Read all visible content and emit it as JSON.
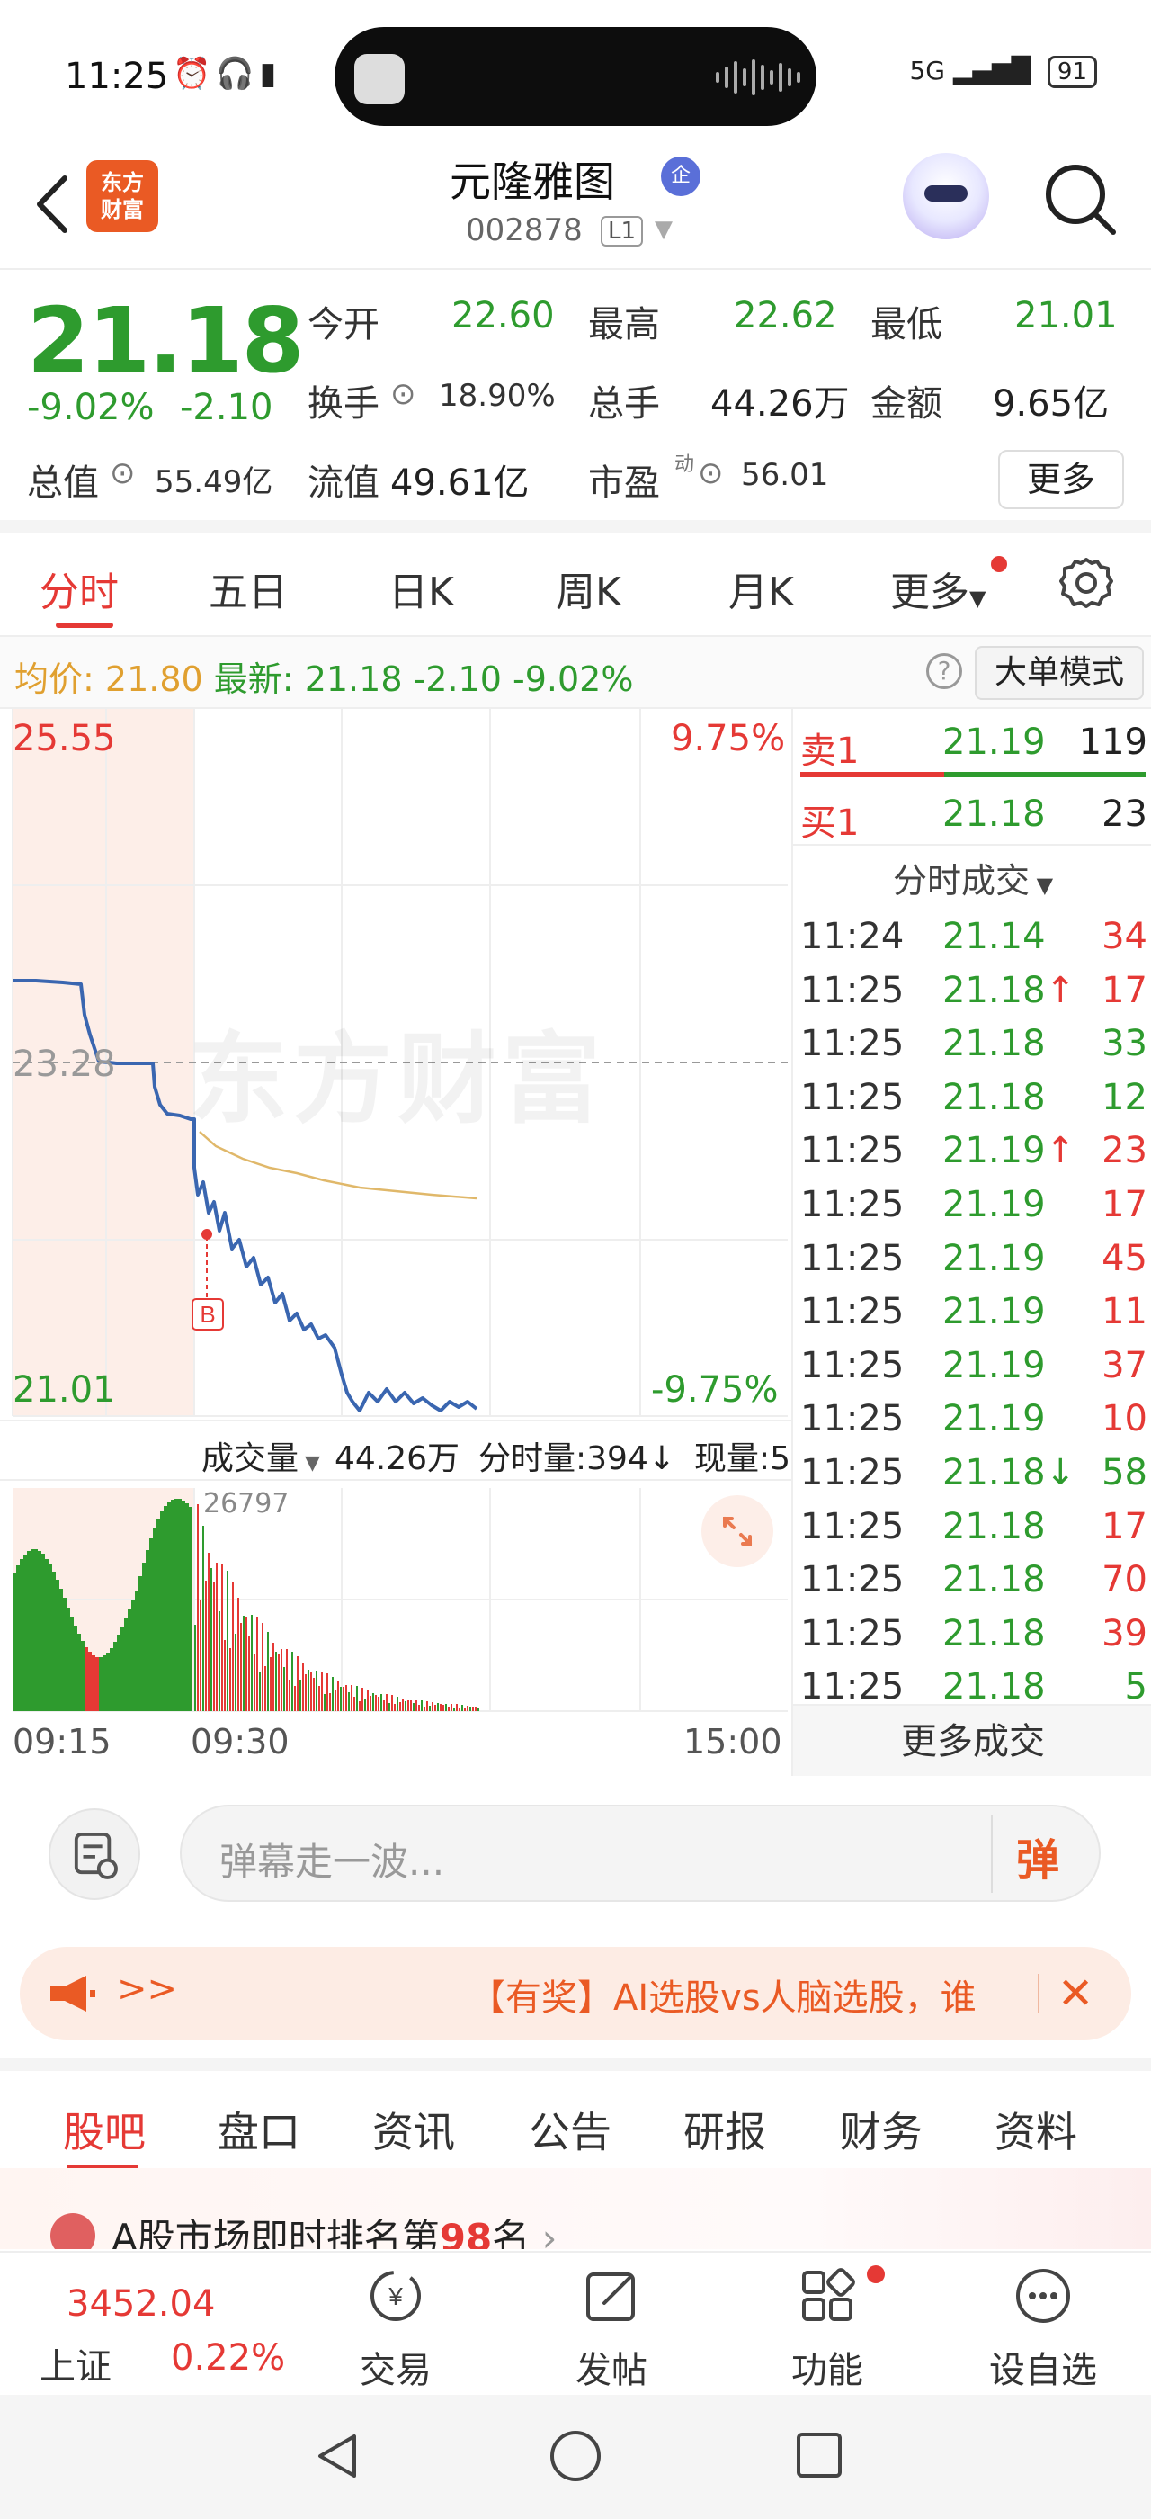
{
  "status_bar": {
    "time": "11:25",
    "network": "5G",
    "battery": "91"
  },
  "header": {
    "stock_name": "元隆雅图",
    "badge": "企",
    "stock_code": "002878",
    "level": "L1",
    "logo_text_1": "东方",
    "logo_text_2": "财富"
  },
  "quote": {
    "last_price": "21.18",
    "change_pct": "-9.02%",
    "change": "-2.10",
    "open_label": "今开",
    "open": "22.60",
    "high_label": "最高",
    "high": "22.62",
    "low_label": "最低",
    "low": "21.01",
    "turnover_label": "换手",
    "turnover": "18.90%",
    "volume_label": "总手",
    "volume": "44.26万",
    "amount_label": "金额",
    "amount": "9.65亿",
    "mcap_label": "总值",
    "mcap": "55.49亿",
    "float_label": "流值",
    "float_cap": "49.61亿",
    "pe_label": "市盈",
    "pe_sup": "动",
    "pe": "56.01",
    "more": "更多"
  },
  "tabs": [
    "分时",
    "五日",
    "日K",
    "周K",
    "月K",
    "更多"
  ],
  "info_row": {
    "avg_label": "均价:",
    "avg": "21.80",
    "latest_label": "最新:",
    "latest": "21.18",
    "change": "-2.10",
    "pct": "-9.02%",
    "big_order_mode": "大单模式"
  },
  "chart": {
    "price_high": "25.55",
    "pct_high": "9.75%",
    "price_mid": "23.28",
    "price_low": "21.01",
    "pct_low": "-9.75%",
    "watermark": "东方财富",
    "marker": "B",
    "volume_label": "成交量",
    "volume": "44.26万",
    "period_volume": "分时量:394↓",
    "current_volume": "现量:5",
    "volume_max": "26797",
    "time_start": "09:15",
    "time_open": "09:30",
    "time_end": "15:00",
    "colors": {
      "price_line": "#3a66b0",
      "avg_line": "#e0b86a",
      "up": "#e53935",
      "down": "#2e9b2e"
    }
  },
  "order_book": {
    "sell1_label": "卖1",
    "sell1_price": "21.19",
    "sell1_vol": "119",
    "buy1_label": "买1",
    "buy1_price": "21.18",
    "buy1_vol": "23"
  },
  "trades_header": "分时成交",
  "trades": [
    {
      "time": "11:24",
      "price": "21.14",
      "arrow": "",
      "vol": "34",
      "side": "red"
    },
    {
      "time": "11:25",
      "price": "21.18",
      "arrow": "↑",
      "vol": "17",
      "side": "red"
    },
    {
      "time": "11:25",
      "price": "21.18",
      "arrow": "",
      "vol": "33",
      "side": "green"
    },
    {
      "time": "11:25",
      "price": "21.18",
      "arrow": "",
      "vol": "12",
      "side": "green"
    },
    {
      "time": "11:25",
      "price": "21.19",
      "arrow": "↑",
      "vol": "23",
      "side": "red"
    },
    {
      "time": "11:25",
      "price": "21.19",
      "arrow": "",
      "vol": "17",
      "side": "red"
    },
    {
      "time": "11:25",
      "price": "21.19",
      "arrow": "",
      "vol": "45",
      "side": "red"
    },
    {
      "time": "11:25",
      "price": "21.19",
      "arrow": "",
      "vol": "11",
      "side": "red"
    },
    {
      "time": "11:25",
      "price": "21.19",
      "arrow": "",
      "vol": "37",
      "side": "red"
    },
    {
      "time": "11:25",
      "price": "21.19",
      "arrow": "",
      "vol": "10",
      "side": "red"
    },
    {
      "time": "11:25",
      "price": "21.18",
      "arrow": "↓",
      "vol": "58",
      "side": "green"
    },
    {
      "time": "11:25",
      "price": "21.18",
      "arrow": "",
      "vol": "17",
      "side": "red"
    },
    {
      "time": "11:25",
      "price": "21.18",
      "arrow": "",
      "vol": "70",
      "side": "red"
    },
    {
      "time": "11:25",
      "price": "21.18",
      "arrow": "",
      "vol": "39",
      "side": "red"
    },
    {
      "time": "11:25",
      "price": "21.18",
      "arrow": "",
      "vol": "5",
      "side": "green"
    }
  ],
  "more_trades": "更多成交",
  "danmu": {
    "placeholder": "弹幕走一波...",
    "button": "弹"
  },
  "promo": {
    "arrows": ">>",
    "text": "【有奖】AI选股vs人脑选股，谁"
  },
  "sub_tabs": [
    "股吧",
    "盘口",
    "资讯",
    "公告",
    "研报",
    "财务",
    "资料"
  ],
  "rank": {
    "prefix": "A股市场即时排名第",
    "rank": "98",
    "suffix": "名",
    "arrow": "›"
  },
  "bottom_nav": {
    "index_value": "3452.04",
    "index_name": "上证",
    "index_change": "0.22%",
    "items": [
      "交易",
      "发帖",
      "功能",
      "设自选"
    ]
  }
}
